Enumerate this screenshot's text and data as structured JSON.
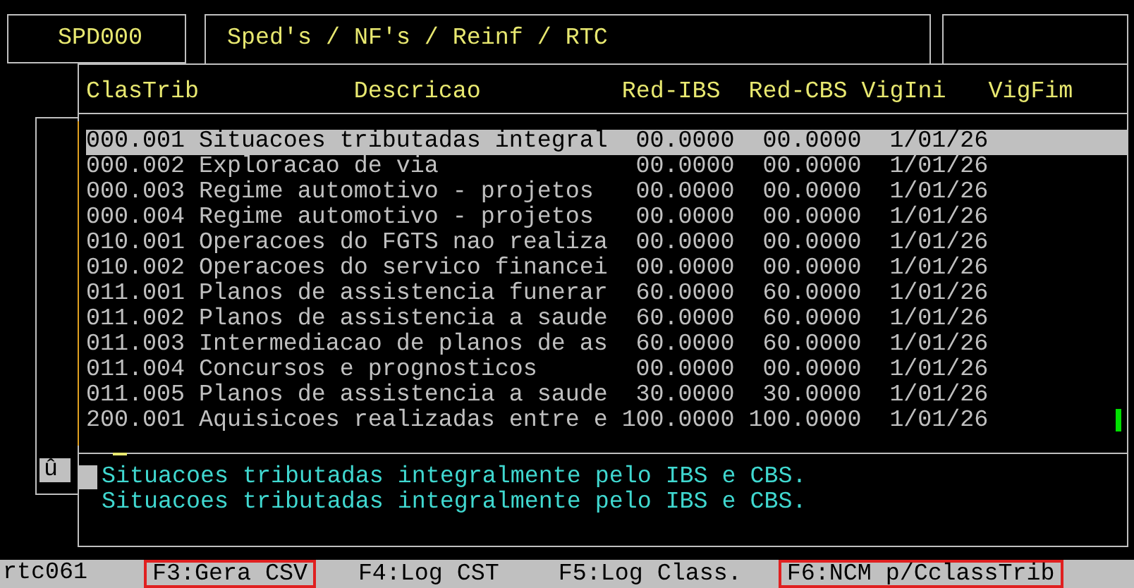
{
  "header": {
    "module_code": "SPD000",
    "title": "Sped's / NF's / Reinf / RTC"
  },
  "table": {
    "columns": [
      "ClasTrib",
      "Descricao",
      "Red-IBS",
      "Red-CBS",
      "VigIni",
      "VigFim"
    ],
    "rows": [
      {
        "clastrib": "000.001",
        "descricao": "Situacoes tributadas integral",
        "red_ibs": "00.0000",
        "red_cbs": "00.0000",
        "vig_ini": "1/01/26",
        "selected": true
      },
      {
        "clastrib": "000.002",
        "descricao": "Exploracao de via",
        "red_ibs": "00.0000",
        "red_cbs": "00.0000",
        "vig_ini": "1/01/26",
        "selected": false
      },
      {
        "clastrib": "000.003",
        "descricao": "Regime automotivo - projetos",
        "red_ibs": "00.0000",
        "red_cbs": "00.0000",
        "vig_ini": "1/01/26",
        "selected": false
      },
      {
        "clastrib": "000.004",
        "descricao": "Regime automotivo - projetos",
        "red_ibs": "00.0000",
        "red_cbs": "00.0000",
        "vig_ini": "1/01/26",
        "selected": false
      },
      {
        "clastrib": "010.001",
        "descricao": "Operacoes do FGTS nao realiza",
        "red_ibs": "00.0000",
        "red_cbs": "00.0000",
        "vig_ini": "1/01/26",
        "selected": false
      },
      {
        "clastrib": "010.002",
        "descricao": "Operacoes do servico financei",
        "red_ibs": "00.0000",
        "red_cbs": "00.0000",
        "vig_ini": "1/01/26",
        "selected": false
      },
      {
        "clastrib": "011.001",
        "descricao": "Planos de assistencia funerar",
        "red_ibs": "60.0000",
        "red_cbs": "60.0000",
        "vig_ini": "1/01/26",
        "selected": false
      },
      {
        "clastrib": "011.002",
        "descricao": "Planos de assistencia a saude",
        "red_ibs": "60.0000",
        "red_cbs": "60.0000",
        "vig_ini": "1/01/26",
        "selected": false
      },
      {
        "clastrib": "011.003",
        "descricao": "Intermediacao de planos de as",
        "red_ibs": "60.0000",
        "red_cbs": "60.0000",
        "vig_ini": "1/01/26",
        "selected": false
      },
      {
        "clastrib": "011.004",
        "descricao": "Concursos e prognosticos",
        "red_ibs": "00.0000",
        "red_cbs": "00.0000",
        "vig_ini": "1/01/26",
        "selected": false
      },
      {
        "clastrib": "011.005",
        "descricao": "Planos de assistencia a saude",
        "red_ibs": "30.0000",
        "red_cbs": "30.0000",
        "vig_ini": "1/01/26",
        "selected": false
      },
      {
        "clastrib": "200.001",
        "descricao": "Aquisicoes realizadas entre e",
        "red_ibs": "100.0000",
        "red_cbs": "100.0000",
        "vig_ini": "1/01/26",
        "selected": false
      }
    ]
  },
  "marker": "û",
  "description_lines": [
    "Situacoes tributadas integralmente pelo IBS e CBS.",
    "Situacoes tributadas integralmente pelo IBS e CBS."
  ],
  "status_bar": {
    "program": "rtc061",
    "keys": [
      {
        "label": "F3:Gera CSV",
        "highlighted": true
      },
      {
        "label": "F4:Log CST",
        "highlighted": false
      },
      {
        "label": "F5:Log Class.",
        "highlighted": false
      },
      {
        "label": "F6:NCM p/CclassTrib",
        "highlighted": true
      }
    ]
  }
}
